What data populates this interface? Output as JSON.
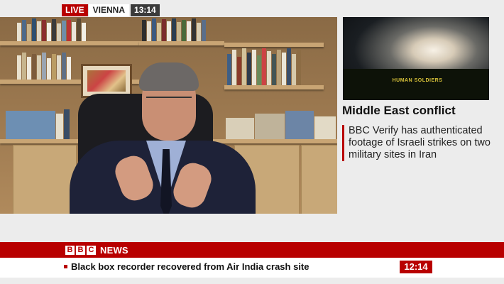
{
  "live_bug": {
    "live": "LIVE",
    "location": "VIENNA",
    "time": "13:14"
  },
  "side_panel": {
    "thumbnail_watermark": "HUMAN SOLDIERS",
    "heading": "Middle East conflict",
    "description": "BBC Verify has authenticated footage of Israeli strikes on two military sites in Iran"
  },
  "bbc_bar": {
    "logo_letters": [
      "B",
      "B",
      "C"
    ],
    "news_label": "NEWS"
  },
  "ticker": {
    "headline": "Black box recorder recovered from Air India crash site",
    "clock": "12:14"
  },
  "colors": {
    "brand_red": "#b80000",
    "panel_bg": "#ececec",
    "text_dark": "#111111"
  }
}
